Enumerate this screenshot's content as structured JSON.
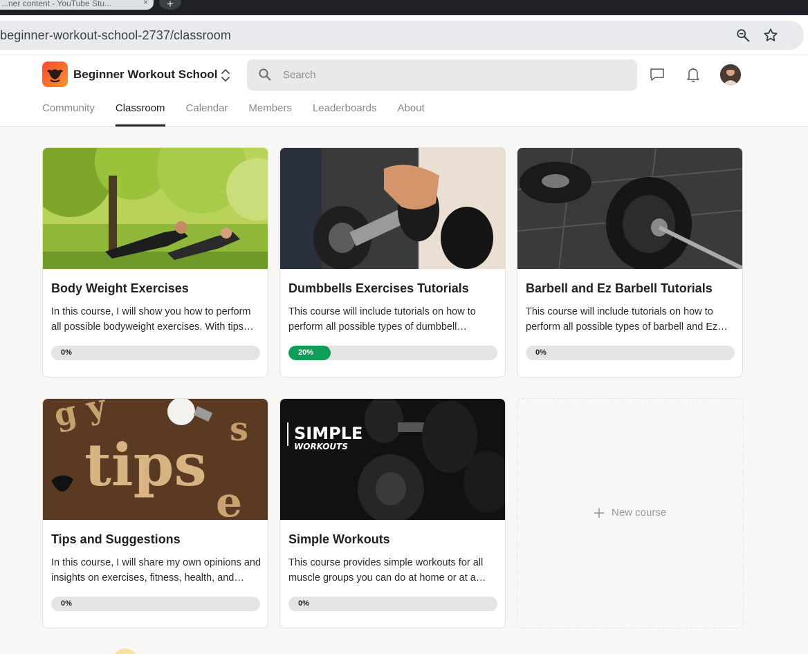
{
  "browser": {
    "tab_title": "...ner content - YouTube Stu...",
    "tab_close": "×",
    "new_tab": "+",
    "url": "beginner-workout-school-2737/classroom",
    "zoom_icon": "zoom-icon",
    "bookmark_icon": "star-icon"
  },
  "header": {
    "group_name": "Beginner Workout School",
    "search": {
      "placeholder": "Search",
      "value": ""
    },
    "icons": [
      "chat-icon",
      "bell-icon"
    ],
    "tabs": [
      {
        "label": "Community",
        "active": false
      },
      {
        "label": "Classroom",
        "active": true
      },
      {
        "label": "Calendar",
        "active": false
      },
      {
        "label": "Members",
        "active": false
      },
      {
        "label": "Leaderboards",
        "active": false
      },
      {
        "label": "About",
        "active": false
      }
    ]
  },
  "courses": [
    {
      "title": "Body Weight Exercises",
      "description": "In this course, I will show you how to perform all possible bodyweight exercises. With tips and detailed explanations.",
      "progress": 0,
      "progress_label": "0%"
    },
    {
      "title": "Dumbbells Exercises Tutorials",
      "description": "This course will include tutorials on how to perform all possible types of dumbbell exercises.",
      "progress": 20,
      "progress_label": "20%"
    },
    {
      "title": "Barbell and Ez Barbell Tutorials",
      "description": "This course will include tutorials on how to perform all possible types of barbell and Ez barbell exercises.",
      "progress": 0,
      "progress_label": "0%"
    },
    {
      "title": "Tips and Suggestions",
      "description": "In this course, I will share my own opinions and insights on exercises, fitness, health, and nutrition.",
      "progress": 0,
      "progress_label": "0%",
      "image_text": "tips"
    },
    {
      "title": "Simple Workouts",
      "description": "This course provides simple workouts for all muscle groups you can do at home or at a gym.",
      "progress": 0,
      "progress_label": "0%",
      "image_text_1": "SIMPLE",
      "image_text_2": "WORKOUTS"
    }
  ],
  "new_course_label": "New course",
  "colors": {
    "progress_fill": "#0f9d58",
    "logo_gradient_start": "#ff4a2f",
    "logo_gradient_end": "#f7932f"
  }
}
